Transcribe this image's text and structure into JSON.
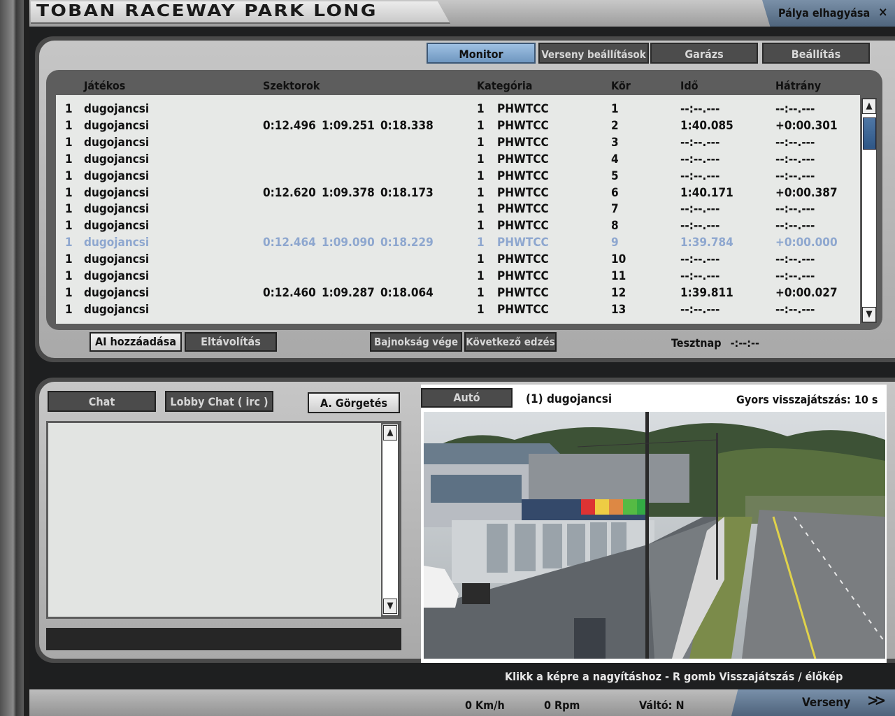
{
  "title_bar": {
    "track_name": "TOBAN RACEWAY PARK LONG",
    "leave_label": "Pálya elhagyása",
    "leave_icon": "close-x-icon"
  },
  "tabs": [
    {
      "label": "Monitor",
      "active": true
    },
    {
      "label": "Verseny beállítások",
      "active": false
    },
    {
      "label": "Garázs",
      "active": false
    },
    {
      "label": "Beállítás",
      "active": false
    }
  ],
  "results": {
    "headers": {
      "player": "Játékos",
      "sectors": "Szektorok",
      "category": "Kategória",
      "lap": "Kör",
      "time": "Idő",
      "gap": "Hátrány"
    },
    "rows": [
      {
        "pos": "1",
        "name": "dugojancsi",
        "s1": "",
        "s2": "",
        "s3": "",
        "cat_num": "1",
        "cat": "PHWTCC",
        "lap": "1",
        "time": "--:--.---",
        "gap": "--:--.---",
        "highlight": false
      },
      {
        "pos": "1",
        "name": "dugojancsi",
        "s1": "0:12.496",
        "s2": "1:09.251",
        "s3": "0:18.338",
        "cat_num": "1",
        "cat": "PHWTCC",
        "lap": "2",
        "time": "1:40.085",
        "gap": "+0:00.301",
        "highlight": false
      },
      {
        "pos": "1",
        "name": "dugojancsi",
        "s1": "",
        "s2": "",
        "s3": "",
        "cat_num": "1",
        "cat": "PHWTCC",
        "lap": "3",
        "time": "--:--.---",
        "gap": "--:--.---",
        "highlight": false
      },
      {
        "pos": "1",
        "name": "dugojancsi",
        "s1": "",
        "s2": "",
        "s3": "",
        "cat_num": "1",
        "cat": "PHWTCC",
        "lap": "4",
        "time": "--:--.---",
        "gap": "--:--.---",
        "highlight": false
      },
      {
        "pos": "1",
        "name": "dugojancsi",
        "s1": "",
        "s2": "",
        "s3": "",
        "cat_num": "1",
        "cat": "PHWTCC",
        "lap": "5",
        "time": "--:--.---",
        "gap": "--:--.---",
        "highlight": false
      },
      {
        "pos": "1",
        "name": "dugojancsi",
        "s1": "0:12.620",
        "s2": "1:09.378",
        "s3": "0:18.173",
        "cat_num": "1",
        "cat": "PHWTCC",
        "lap": "6",
        "time": "1:40.171",
        "gap": "+0:00.387",
        "highlight": false
      },
      {
        "pos": "1",
        "name": "dugojancsi",
        "s1": "",
        "s2": "",
        "s3": "",
        "cat_num": "1",
        "cat": "PHWTCC",
        "lap": "7",
        "time": "--:--.---",
        "gap": "--:--.---",
        "highlight": false
      },
      {
        "pos": "1",
        "name": "dugojancsi",
        "s1": "",
        "s2": "",
        "s3": "",
        "cat_num": "1",
        "cat": "PHWTCC",
        "lap": "8",
        "time": "--:--.---",
        "gap": "--:--.---",
        "highlight": false
      },
      {
        "pos": "1",
        "name": "dugojancsi",
        "s1": "0:12.464",
        "s2": "1:09.090",
        "s3": "0:18.229",
        "cat_num": "1",
        "cat": "PHWTCC",
        "lap": "9",
        "time": "1:39.784",
        "gap": "+0:00.000",
        "highlight": true
      },
      {
        "pos": "1",
        "name": "dugojancsi",
        "s1": "",
        "s2": "",
        "s3": "",
        "cat_num": "1",
        "cat": "PHWTCC",
        "lap": "10",
        "time": "--:--.---",
        "gap": "--:--.---",
        "highlight": false
      },
      {
        "pos": "1",
        "name": "dugojancsi",
        "s1": "",
        "s2": "",
        "s3": "",
        "cat_num": "1",
        "cat": "PHWTCC",
        "lap": "11",
        "time": "--:--.---",
        "gap": "--:--.---",
        "highlight": false
      },
      {
        "pos": "1",
        "name": "dugojancsi",
        "s1": "0:12.460",
        "s2": "1:09.287",
        "s3": "0:18.064",
        "cat_num": "1",
        "cat": "PHWTCC",
        "lap": "12",
        "time": "1:39.811",
        "gap": "+0:00.027",
        "highlight": false
      },
      {
        "pos": "1",
        "name": "dugojancsi",
        "s1": "",
        "s2": "",
        "s3": "",
        "cat_num": "1",
        "cat": "PHWTCC",
        "lap": "13",
        "time": "--:--.---",
        "gap": "--:--.---",
        "highlight": false
      }
    ],
    "highlight_color": "#8ea7cf"
  },
  "controls": {
    "add_ai": "AI hozzáadása",
    "remove": "Eltávolítás",
    "end_championship": "Bajnokság vége",
    "next_session": "Következő edzés",
    "session_label": "Tesztnap",
    "session_time": "-:--:--"
  },
  "chat": {
    "chat_tab": "Chat",
    "lobby_tab": "Lobby Chat ( irc )",
    "autoscroll": "A. Görgetés"
  },
  "video": {
    "camera_button": "Autó",
    "driver": "(1) dugojancsi",
    "instant_replay": "Gyors visszajátszás: 10 s",
    "hint": "Klikk a képre a nagyításhoz - R gomb  Visszajátszás / élőkép"
  },
  "status_bar": {
    "speed": "0 Km/h",
    "rpm": "0 Rpm",
    "gear": "Váltó: N",
    "race_label": "Verseny",
    "race_icon": "double-chevron-right-icon"
  },
  "colors": {
    "active_tab": "#7fa6cf",
    "panel": "#b8b8b8",
    "dark": "#4b4b4b"
  }
}
